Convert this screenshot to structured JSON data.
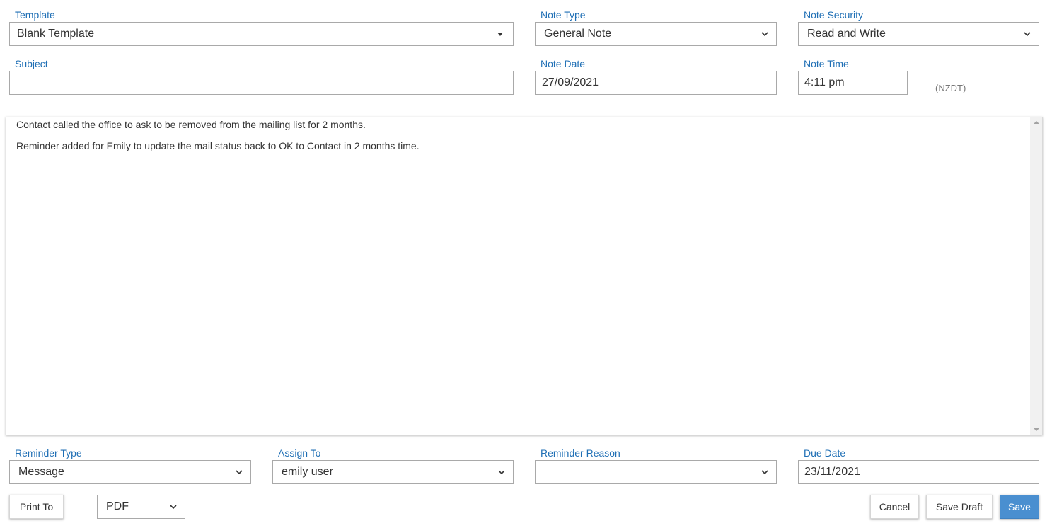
{
  "form": {
    "template": {
      "label": "Template",
      "value": "Blank Template"
    },
    "note_type": {
      "label": "Note Type",
      "value": "General Note"
    },
    "note_security": {
      "label": "Note Security",
      "value": "Read and Write"
    },
    "subject": {
      "label": "Subject",
      "value": ""
    },
    "note_date": {
      "label": "Note Date",
      "value": "27/09/2021"
    },
    "note_time": {
      "label": "Note Time",
      "value": "4:11 pm"
    },
    "timezone": "(NZDT)"
  },
  "editor": {
    "paragraphs": [
      "Contact called the office to ask to be removed from the mailing list for 2 months.",
      "Reminder added for Emily to update the mail status back to OK to Contact in 2 months time."
    ]
  },
  "reminder": {
    "type": {
      "label": "Reminder Type",
      "value": "Message"
    },
    "assign_to": {
      "label": "Assign To",
      "value": "emily user"
    },
    "reason": {
      "label": "Reminder Reason",
      "value": ""
    },
    "due_date": {
      "label": "Due Date",
      "value": "23/11/2021"
    }
  },
  "footer": {
    "print_to_label": "Print To",
    "print_format": "PDF",
    "cancel_label": "Cancel",
    "save_draft_label": "Save Draft",
    "save_label": "Save"
  },
  "icons": {
    "select_chevron": "chevron-down-icon",
    "template_caret": "caret-down-icon",
    "scroll_up": "scroll-up-arrow-icon",
    "scroll_down": "scroll-down-arrow-icon"
  },
  "colors": {
    "label": "#1f6fb5",
    "primary_button": "#4a8fd0",
    "border": "#a9a9a9"
  }
}
